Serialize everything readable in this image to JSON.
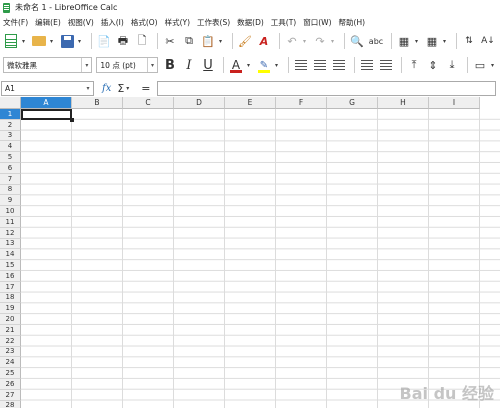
{
  "window": {
    "title": "未命名 1 - LibreOffice Calc"
  },
  "menubar": {
    "items": [
      "文件(F)",
      "编辑(E)",
      "视图(V)",
      "插入(I)",
      "格式(O)",
      "样式(Y)",
      "工作表(S)",
      "数据(D)",
      "工具(T)",
      "窗口(W)",
      "帮助(H)"
    ]
  },
  "format_toolbar": {
    "font_name": "微软雅黑",
    "font_size": "10 点 (pt)",
    "bold": "B",
    "italic": "I",
    "underline": "U",
    "font_color_letter": "A",
    "font_color": "#c9211e",
    "highlight_color": "#ffff00"
  },
  "formula_bar": {
    "name_box": "A1",
    "fx": "fx",
    "sum": "Σ",
    "equals": "=",
    "content": ""
  },
  "sheet": {
    "columns": [
      "A",
      "B",
      "C",
      "D",
      "E",
      "F",
      "G",
      "H",
      "I"
    ],
    "rows": [
      "1",
      "2",
      "3",
      "4",
      "5",
      "6",
      "7",
      "8",
      "9",
      "10",
      "11",
      "12",
      "13",
      "14",
      "15",
      "16",
      "17",
      "18",
      "19",
      "20",
      "21",
      "22",
      "23",
      "24",
      "25",
      "26",
      "27",
      "28"
    ],
    "active_cell": "A1"
  },
  "watermark": "Bai du 经验"
}
